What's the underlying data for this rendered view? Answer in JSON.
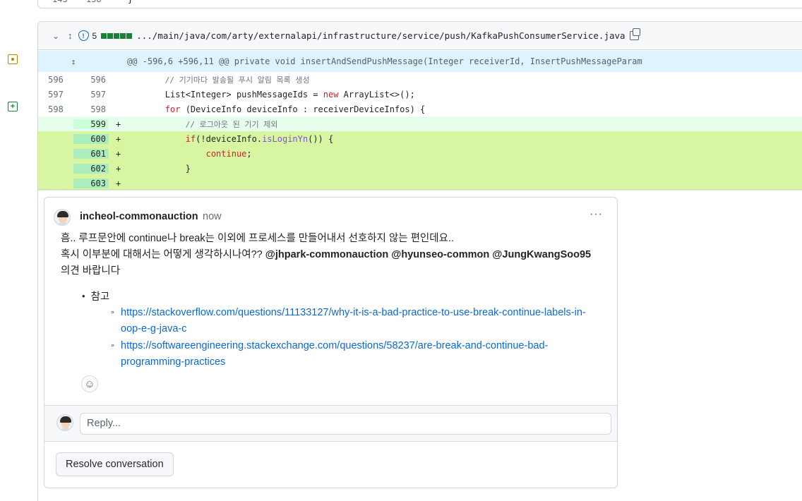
{
  "previous_file": {
    "line_old": "143",
    "line_new": "158",
    "code": "}"
  },
  "file": {
    "count": "5",
    "path": ".../main/java/com/arty/externalapi/infrastructure/service/push/KafkaPushConsumerService.java",
    "icons": [
      "chevron-down-icon",
      "unfold-icon",
      "shield-icon",
      "copy-icon"
    ]
  },
  "diff": {
    "hunk_expand": "…",
    "hunk_header": "@@ -596,6 +596,11 @@ private void insertAndSendPushMessage(Integer receiverId, InsertPushMessageParam",
    "context": [
      {
        "old": "596",
        "new": "596",
        "indent": "        ",
        "comment": "// 기기마다 발송될 푸시 알림 목록 생성"
      },
      {
        "old": "597",
        "new": "597",
        "indent": "        ",
        "pre": "List<Integer> pushMessageIds = ",
        "kw": "new",
        "post": " ArrayList<>();"
      },
      {
        "old": "598",
        "new": "598",
        "indent": "        ",
        "kw": "for",
        "post": " (DeviceInfo deviceInfo : receiverDeviceInfos) {"
      }
    ],
    "added": [
      {
        "new": "599",
        "sign": "+",
        "indent": "            ",
        "comment": "// 로그아웃 된 기기 제외"
      },
      {
        "new": "600",
        "sign": "+",
        "indent": "            ",
        "kw": "if",
        "pre": "(!deviceInfo.",
        "fn": "isLoginYn",
        "post": "()) {"
      },
      {
        "new": "601",
        "sign": "+",
        "indent": "                ",
        "kw": "continue",
        "post": ";"
      },
      {
        "new": "602",
        "sign": "+",
        "indent": "            ",
        "post": "}"
      },
      {
        "new": "603",
        "sign": "+",
        "indent": "",
        "post": ""
      }
    ]
  },
  "comment": {
    "author": "incheol-commonauction",
    "time": "now",
    "menu": "···",
    "line1": "흠.. 루프문안에 continue나 break는 이외에 프로세스를 만들어내서 선호하지 않는 편인데요..",
    "line2_prefix": "혹시 이부분에 대해서는 어떻게 생각하시나여?? ",
    "mentions": [
      "@jhpark-commonauction",
      "@hyunseo-common",
      "@JungKwangSoo95"
    ],
    "line3": "의견 바랍니다",
    "list_label": "참고",
    "links": [
      "https://stackoverflow.com/questions/11133127/why-it-is-a-bad-practice-to-use-break-continue-labels-in-oop-e-g-java-c",
      "https://softwareengineering.stackexchange.com/questions/58237/are-break-and-continue-bad-programming-practices"
    ],
    "reply_placeholder": "Reply...",
    "resolve_label": "Resolve conversation"
  },
  "colors": {
    "added_bg": "#e6ffec",
    "highlight_bg": "#d8f5a2",
    "hunk_bg": "#ddf4ff",
    "link": "#0969da",
    "keyword": "#cf222e"
  }
}
